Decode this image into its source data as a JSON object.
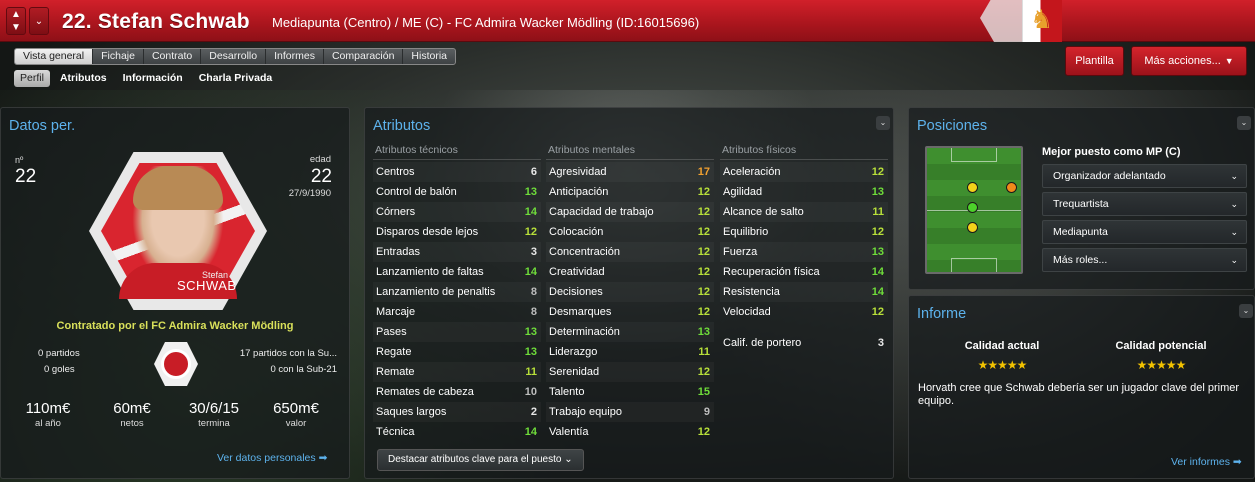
{
  "header": {
    "title": "22. Stefan Schwab",
    "subtitle": "Mediapunta (Centro) / ME (C) - FC Admira Wacker Mödling (ID:16015696)",
    "nav_up": "▲",
    "nav_down": "▼"
  },
  "tabs": [
    "Vista general",
    "Fichaje",
    "Contrato",
    "Desarrollo",
    "Informes",
    "Comparación",
    "Historia"
  ],
  "subtabs": [
    "Perfil",
    "Atributos",
    "Información",
    "Charla Privada"
  ],
  "buttons": {
    "plantilla": "Plantilla",
    "mas_acciones": "Más acciones..."
  },
  "datos": {
    "title": "Datos per.",
    "num_label": "nº",
    "num_value": "22",
    "age_label": "edad",
    "age_value": "22",
    "dob": "27/9/1990",
    "portrait_first": "Stefan",
    "portrait_last": "SCHWAB",
    "contract": "Contratado por el FC Admira Wacker Mödling",
    "partidos": "0 partidos",
    "goles": "0 goles",
    "sub_partidos": "17 partidos con la Su...",
    "sub21": "0 con la Sub-21",
    "fin": [
      {
        "value": "110m€",
        "label": "al año"
      },
      {
        "value": "60m€",
        "label": "netos"
      },
      {
        "value": "30/6/15",
        "label": "termina"
      },
      {
        "value": "650m€",
        "label": "valor"
      }
    ],
    "link": "Ver datos personales ➡"
  },
  "atributos": {
    "title": "Atributos",
    "tecnicos": {
      "header": "Atributos técnicos",
      "rows": [
        {
          "name": "Centros",
          "value": "6",
          "tone": "white"
        },
        {
          "name": "Control de balón",
          "value": "13",
          "tone": "green"
        },
        {
          "name": "Córners",
          "value": "14",
          "tone": "green"
        },
        {
          "name": "Disparos desde lejos",
          "value": "12",
          "tone": "lime"
        },
        {
          "name": "Entradas",
          "value": "3",
          "tone": "white"
        },
        {
          "name": "Lanzamiento de faltas",
          "value": "14",
          "tone": "green"
        },
        {
          "name": "Lanzamiento de penaltis",
          "value": "8",
          "tone": "grey"
        },
        {
          "name": "Marcaje",
          "value": "8",
          "tone": "grey"
        },
        {
          "name": "Pases",
          "value": "13",
          "tone": "green"
        },
        {
          "name": "Regate",
          "value": "13",
          "tone": "green"
        },
        {
          "name": "Remate",
          "value": "11",
          "tone": "lime"
        },
        {
          "name": "Remates de cabeza",
          "value": "10",
          "tone": "grey"
        },
        {
          "name": "Saques largos",
          "value": "2",
          "tone": "white"
        },
        {
          "name": "Técnica",
          "value": "14",
          "tone": "green"
        }
      ]
    },
    "mentales": {
      "header": "Atributos mentales",
      "rows": [
        {
          "name": "Agresividad",
          "value": "17",
          "tone": "orange"
        },
        {
          "name": "Anticipación",
          "value": "12",
          "tone": "lime"
        },
        {
          "name": "Capacidad de trabajo",
          "value": "12",
          "tone": "lime"
        },
        {
          "name": "Colocación",
          "value": "12",
          "tone": "lime"
        },
        {
          "name": "Concentración",
          "value": "12",
          "tone": "lime"
        },
        {
          "name": "Creatividad",
          "value": "12",
          "tone": "lime"
        },
        {
          "name": "Decisiones",
          "value": "12",
          "tone": "lime"
        },
        {
          "name": "Desmarques",
          "value": "12",
          "tone": "lime"
        },
        {
          "name": "Determinación",
          "value": "13",
          "tone": "green"
        },
        {
          "name": "Liderazgo",
          "value": "11",
          "tone": "lime"
        },
        {
          "name": "Serenidad",
          "value": "12",
          "tone": "lime"
        },
        {
          "name": "Talento",
          "value": "15",
          "tone": "green"
        },
        {
          "name": "Trabajo equipo",
          "value": "9",
          "tone": "grey"
        },
        {
          "name": "Valentía",
          "value": "12",
          "tone": "lime"
        }
      ]
    },
    "fisicos": {
      "header": "Atributos físicos",
      "rows": [
        {
          "name": "Aceleración",
          "value": "12",
          "tone": "lime"
        },
        {
          "name": "Agilidad",
          "value": "13",
          "tone": "green"
        },
        {
          "name": "Alcance de salto",
          "value": "11",
          "tone": "lime"
        },
        {
          "name": "Equilibrio",
          "value": "12",
          "tone": "lime"
        },
        {
          "name": "Fuerza",
          "value": "13",
          "tone": "green"
        },
        {
          "name": "Recuperación física",
          "value": "14",
          "tone": "green"
        },
        {
          "name": "Resistencia",
          "value": "14",
          "tone": "green"
        },
        {
          "name": "Velocidad",
          "value": "12",
          "tone": "lime"
        }
      ]
    },
    "portero": {
      "name": "Calif. de portero",
      "value": "3"
    },
    "highlight_button": "Destacar atributos clave para el puesto ⌄"
  },
  "posiciones": {
    "title": "Posiciones",
    "best": "Mejor puesto como MP (C)",
    "roles": [
      "Organizador adelantado",
      "Trequartista",
      "Mediapunta",
      "Más roles..."
    ]
  },
  "informe": {
    "title": "Informe",
    "actual_label": "Calidad actual",
    "potencial_label": "Calidad potencial",
    "actual_stars": "★★★★★",
    "potencial_stars": "★★★★★",
    "text": "Horvath cree que Schwab debería ser un jugador clave del primer equipo.",
    "link": "Ver informes ➡"
  },
  "colors": {
    "header_red": "#c4161c",
    "accent_blue": "#5db2ec",
    "contract_yellow": "#d9e05a",
    "attr_green": "#6fdc3a",
    "attr_orange": "#f0a030",
    "star_gold": "#f2c200"
  },
  "icons": {
    "collapse": "chevron-down-icon",
    "arrow": "arrow-right-icon"
  }
}
